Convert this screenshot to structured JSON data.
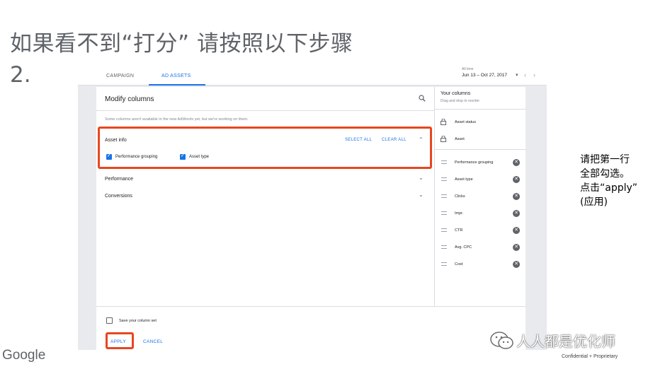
{
  "slide": {
    "title": "如果看不到“打分” 请按照以下步骤",
    "step": "2.",
    "note_lines": [
      "请把第一行",
      "全部勾选。",
      "点击“apply”",
      "(应用)"
    ],
    "logo": "Google",
    "confidential": "Confidential + Proprietary",
    "watermark": "人人都是优化师"
  },
  "tabs": [
    {
      "label": "CAMPAIGN",
      "active": false
    },
    {
      "label": "AD ASSETS",
      "active": true
    }
  ],
  "date": {
    "label": "All time",
    "range": "Jun 13 – Oct 27, 2017"
  },
  "modal": {
    "title": "Modify columns",
    "notice": "Some columns aren't available in the new AdWords yet, but we're working on them.",
    "sections": [
      {
        "label": "Asset info",
        "expanded": true,
        "select_all": "SELECT ALL",
        "clear_all": "CLEAR ALL",
        "options": [
          {
            "label": "Performance grouping",
            "checked": true
          },
          {
            "label": "Asset type",
            "checked": true
          }
        ]
      },
      {
        "label": "Performance",
        "expanded": false
      },
      {
        "label": "Conversions",
        "expanded": false
      }
    ],
    "save_label": "Save your column set",
    "apply_label": "APPLY",
    "cancel_label": "CANCEL"
  },
  "your_columns": {
    "title": "Your columns",
    "subtitle": "Drag and drop to reorder",
    "locked": [
      "Asset status",
      "Asset"
    ],
    "items": [
      "Performance grouping",
      "Asset type",
      "Clicks",
      "Impr.",
      "CTR",
      "Avg. CPC",
      "Cost"
    ]
  },
  "colors": {
    "accent": "#1a73e8",
    "highlight": "#e8461f",
    "title_gray": "#5f6368"
  }
}
